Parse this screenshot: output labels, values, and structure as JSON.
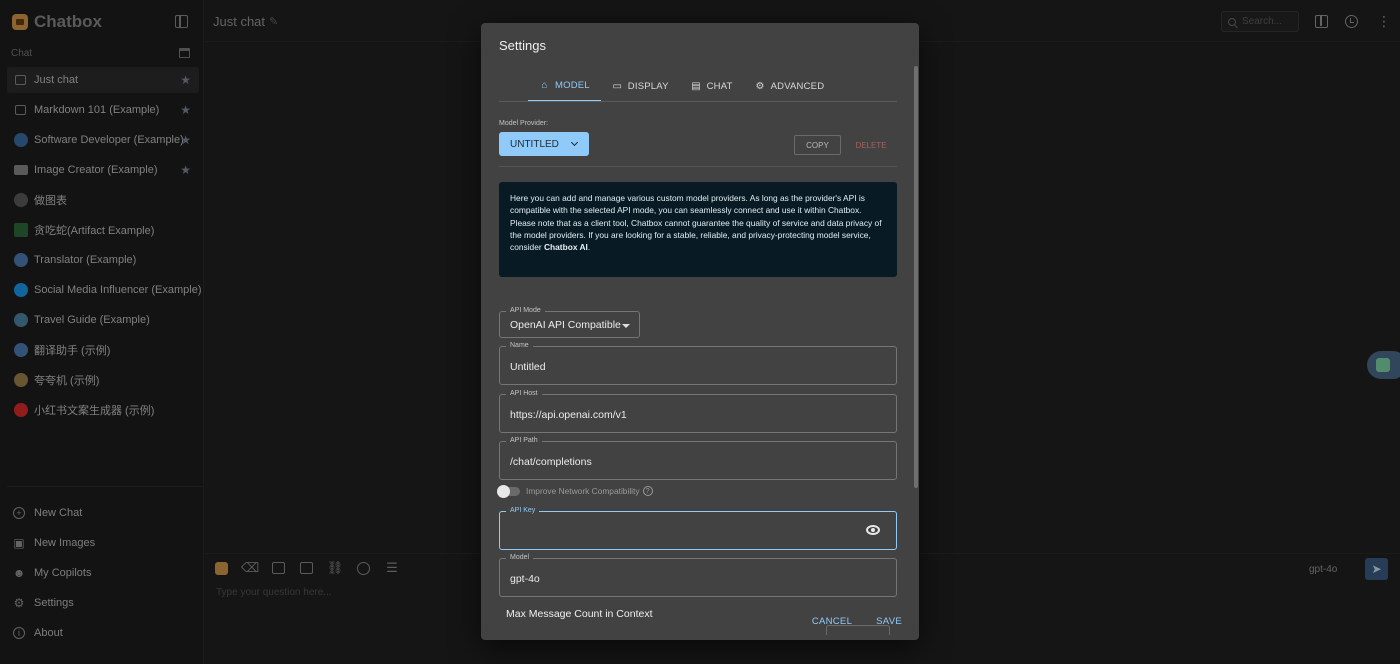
{
  "app": {
    "name": "Chatbox"
  },
  "sidebar": {
    "section_label": "Chat",
    "sessions": [
      {
        "label": "Just chat",
        "icon": "chat-bubble-icon",
        "starred": true,
        "active": true
      },
      {
        "label": "Markdown 101 (Example)",
        "icon": "chat-bubble-icon",
        "starred": true
      },
      {
        "label": "Software Developer (Example)",
        "icon": "developer-avatar-icon",
        "starred": true
      },
      {
        "label": "Image Creator (Example)",
        "icon": "image-creator-icon",
        "starred": true
      },
      {
        "label": "做图表",
        "icon": "chart-avatar-icon"
      },
      {
        "label": "贪吃蛇(Artifact Example)",
        "icon": "snake-game-icon"
      },
      {
        "label": "Translator (Example)",
        "icon": "translator-avatar-icon"
      },
      {
        "label": "Social Media Influencer (Example)",
        "icon": "twitter-bird-icon"
      },
      {
        "label": "Travel Guide (Example)",
        "icon": "travel-avatar-icon"
      },
      {
        "label": "翻译助手 (示例)",
        "icon": "translator-avatar-icon"
      },
      {
        "label": "夸夸机 (示例)",
        "icon": "praise-avatar-icon"
      },
      {
        "label": "小红书文案生成器 (示例)",
        "icon": "rednote-avatar-icon"
      }
    ],
    "bottom_nav": [
      {
        "label": "New Chat",
        "icon": "plus-circle-icon"
      },
      {
        "label": "New Images",
        "icon": "image-icon"
      },
      {
        "label": "My Copilots",
        "icon": "robot-icon"
      },
      {
        "label": "Settings",
        "icon": "gear-icon"
      },
      {
        "label": "About",
        "icon": "info-icon"
      }
    ]
  },
  "header": {
    "title": "Just chat",
    "search_placeholder": "Search..."
  },
  "composer": {
    "placeholder": "Type your question here...",
    "model": "gpt-4o"
  },
  "settings": {
    "title": "Settings",
    "tabs": [
      {
        "label": "MODEL",
        "icon": "model-icon",
        "active": true
      },
      {
        "label": "DISPLAY",
        "icon": "display-icon"
      },
      {
        "label": "CHAT",
        "icon": "chat-icon"
      },
      {
        "label": "ADVANCED",
        "icon": "gear-icon"
      }
    ],
    "model_provider_label": "Model Provider:",
    "model_provider_value": "UNTITLED",
    "copy_label": "COPY",
    "delete_label": "DELETE",
    "info_line1": "Here you can add and manage various custom model providers. As long as the provider's API is compatible with the selected API mode, you can seamlessly connect and use it within Chatbox.",
    "info_line2": "Please note that as a client tool, Chatbox cannot guarantee the quality of service and data privacy of the model providers. If you are looking for a stable, reliable, and privacy-protecting model service, consider",
    "info_link": "Chatbox AI",
    "info_end": ".",
    "api_mode": {
      "label": "API Mode",
      "value": "OpenAI API Compatible"
    },
    "name": {
      "label": "Name",
      "value": "Untitled"
    },
    "api_host": {
      "label": "API Host",
      "value": "https://api.openai.com/v1"
    },
    "api_path": {
      "label": "API Path",
      "value": "/chat/completions"
    },
    "improve_network": {
      "label": "Improve Network Compatibility",
      "enabled": false
    },
    "api_key": {
      "label": "API Key",
      "value": ""
    },
    "model": {
      "label": "Model",
      "value": "gpt-4o"
    },
    "max_message_label": "Max Message Count in Context",
    "cancel_label": "CANCEL",
    "save_label": "SAVE"
  },
  "colors": {
    "accent": "#90caf9",
    "background": "#212121",
    "dialog": "#424242",
    "info_box": "#081b24",
    "delete": "#a85e5e"
  }
}
